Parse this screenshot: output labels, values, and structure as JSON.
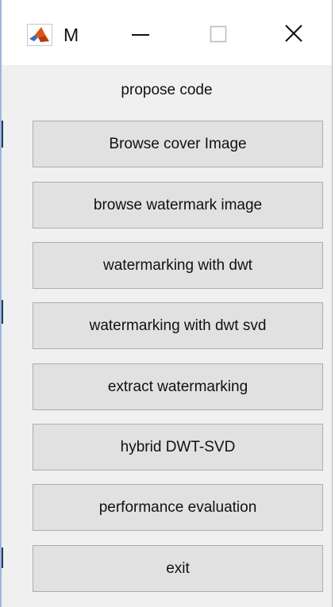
{
  "window": {
    "title": "M",
    "icon": "matlab-icon",
    "controls": {
      "minimize": "minimize-icon",
      "maximize": "maximize-icon",
      "close": "close-icon"
    }
  },
  "panel": {
    "heading": "propose code",
    "buttons": [
      "Browse cover Image",
      "browse watermark image",
      "watermarking with dwt",
      "watermarking with dwt svd",
      "extract watermarking",
      "hybrid DWT-SVD",
      "performance evaluation",
      "exit"
    ]
  },
  "colors": {
    "button_face": "#e1e1e1",
    "button_border": "#adadad",
    "window_background": "#f0f0f0",
    "titlebar_background": "#ffffff"
  }
}
